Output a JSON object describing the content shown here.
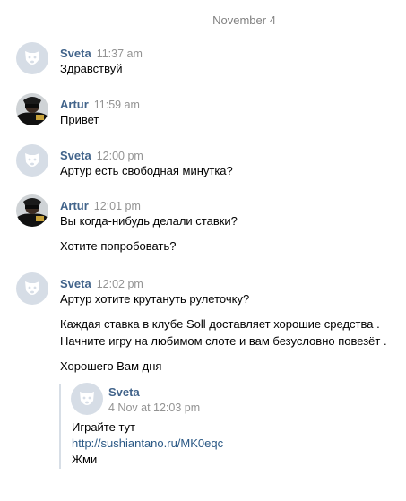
{
  "date_separator": "November 4",
  "messages": [
    {
      "author": "Sveta",
      "time": "11:37 am",
      "lines": [
        "Здравствуй"
      ]
    },
    {
      "author": "Artur",
      "time": "11:59 am",
      "lines": [
        "Привет"
      ]
    },
    {
      "author": "Sveta",
      "time": "12:00 pm",
      "lines": [
        "Артур есть свободная минутка?"
      ]
    },
    {
      "author": "Artur",
      "time": "12:01 pm",
      "lines": [
        "Вы когда-нибудь делали ставки?",
        "Хотите попробовать?"
      ]
    },
    {
      "author": "Sveta",
      "time": "12:02 pm",
      "lines": [
        "Артур хотите крутануть рулеточку?",
        "Каждая ставка в клубе Soll доставляет хорошие средства .",
        "Начните игру на любимом слоте и вам безусловно повезёт .",
        "Хорошего Вам дня"
      ]
    }
  ],
  "forwarded": {
    "author": "Sveta",
    "date": "4 Nov at 12:03 pm",
    "text": "Играйте тут",
    "link": "http://sushiantano.ru/MK0eqc",
    "after": "Жми"
  },
  "avatars": {
    "Sveta": "default-dog-avatar",
    "Artur": "photo-avatar"
  },
  "colors": {
    "author": "#42648b",
    "time": "#939393",
    "link": "#2a5885",
    "avatar_default_bg": "#d6dde6"
  }
}
